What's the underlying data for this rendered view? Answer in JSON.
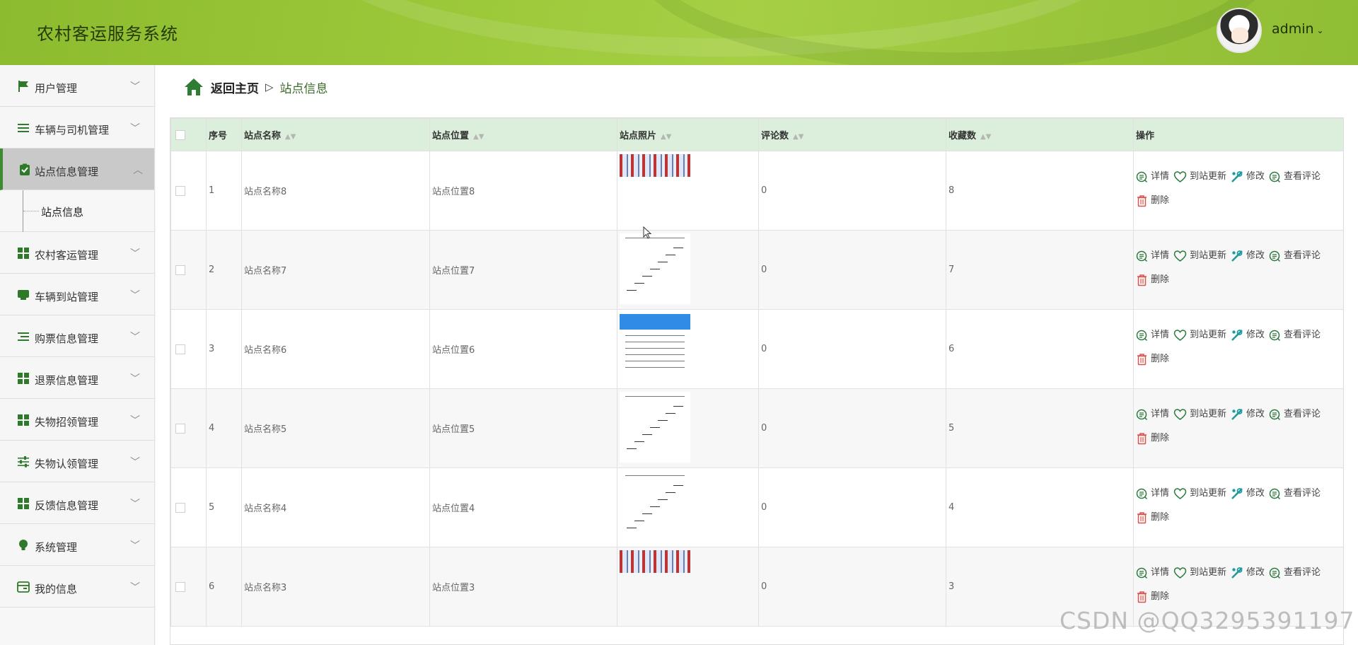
{
  "app": {
    "title": "农村客运服务系统",
    "user": "admin"
  },
  "sidebar": {
    "items": [
      {
        "label": "用户管理",
        "icon": "flag-icon"
      },
      {
        "label": "车辆与司机管理",
        "icon": "list-icon"
      },
      {
        "label": "站点信息管理",
        "icon": "clipboard-check-icon",
        "active": true,
        "sub": "站点信息"
      },
      {
        "label": "农村客运管理",
        "icon": "grid-icon"
      },
      {
        "label": "车辆到站管理",
        "icon": "inbox-icon"
      },
      {
        "label": "购票信息管理",
        "icon": "indent-list-icon"
      },
      {
        "label": "退票信息管理",
        "icon": "grid-icon"
      },
      {
        "label": "失物招领管理",
        "icon": "grid-icon"
      },
      {
        "label": "失物认领管理",
        "icon": "sliders-icon"
      },
      {
        "label": "反馈信息管理",
        "icon": "grid-icon"
      },
      {
        "label": "系统管理",
        "icon": "bulb-icon"
      },
      {
        "label": "我的信息",
        "icon": "card-icon"
      }
    ]
  },
  "breadcrumb": {
    "home": "返回主页",
    "separator": "▷",
    "current": "站点信息"
  },
  "table": {
    "columns": [
      "序号",
      "站点名称",
      "站点位置",
      "站点照片",
      "评论数",
      "收藏数",
      "操作"
    ],
    "rows": [
      {
        "index": "1",
        "name": "站点名称8",
        "location": "站点位置8",
        "comments": "0",
        "favorites": "8"
      },
      {
        "index": "2",
        "name": "站点名称7",
        "location": "站点位置7",
        "comments": "0",
        "favorites": "7"
      },
      {
        "index": "3",
        "name": "站点名称6",
        "location": "站点位置6",
        "comments": "0",
        "favorites": "6"
      },
      {
        "index": "4",
        "name": "站点名称5",
        "location": "站点位置5",
        "comments": "0",
        "favorites": "5"
      },
      {
        "index": "5",
        "name": "站点名称4",
        "location": "站点位置4",
        "comments": "0",
        "favorites": "4"
      },
      {
        "index": "6",
        "name": "站点名称3",
        "location": "站点位置3",
        "comments": "0",
        "favorites": "3"
      }
    ],
    "actions": {
      "detail": "详情",
      "arrival": "到站更新",
      "edit": "修改",
      "comments": "查看评论",
      "delete": "删除"
    }
  },
  "watermark": "CSDN @QQ3295391197",
  "colors": {
    "header": "#9cc93a",
    "accent": "#3a8c2e",
    "table_header": "#dcefdc"
  }
}
